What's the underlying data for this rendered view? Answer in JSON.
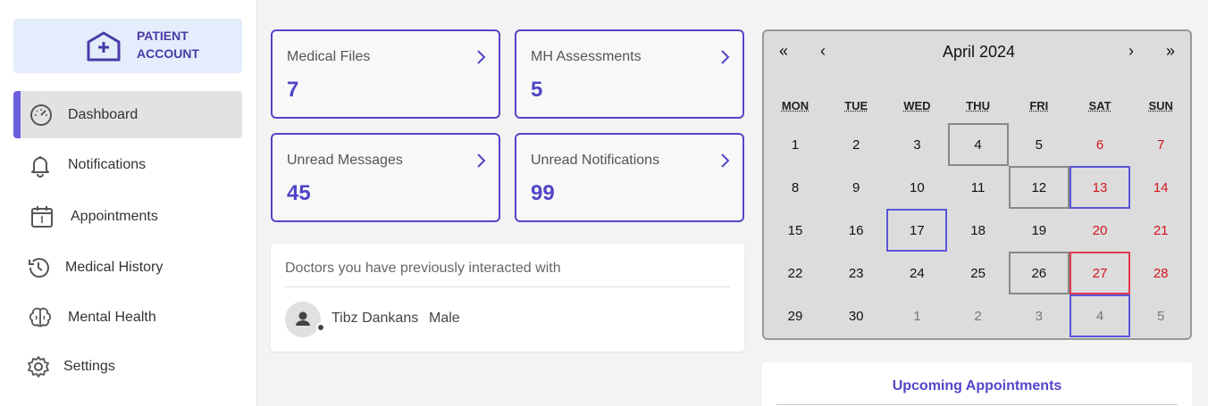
{
  "account": {
    "line1": "PATIENT",
    "line2": "ACCOUNT"
  },
  "nav": [
    {
      "label": "Dashboard",
      "icon": "gauge-icon",
      "active": true
    },
    {
      "label": "Notifications",
      "icon": "bell-icon"
    },
    {
      "label": "Appointments",
      "icon": "calendar-icon"
    },
    {
      "label": "Medical History",
      "icon": "history-icon"
    },
    {
      "label": "Mental Health",
      "icon": "brain-icon"
    },
    {
      "label": "Settings",
      "icon": "gear-icon"
    }
  ],
  "cards": [
    {
      "title": "Medical Files",
      "value": "7"
    },
    {
      "title": "MH Assessments",
      "value": "5"
    },
    {
      "title": "Unread Messages",
      "value": "45"
    },
    {
      "title": "Unread Notifications",
      "value": "99"
    }
  ],
  "doctors": {
    "heading": "Doctors you have previously interacted with",
    "items": [
      {
        "name": "Tibz Dankans",
        "gender": "Male"
      }
    ]
  },
  "calendar": {
    "title": "April 2024",
    "nav": {
      "prev_year": "«",
      "prev_month": "‹",
      "next_month": "›",
      "next_year": "»"
    },
    "weekdays": [
      "MON",
      "TUE",
      "WED",
      "THU",
      "FRI",
      "SAT",
      "SUN"
    ],
    "weeks": [
      [
        "1",
        "2",
        "3",
        "4",
        "5",
        "6",
        "7"
      ],
      [
        "8",
        "9",
        "10",
        "11",
        "12",
        "13",
        "14"
      ],
      [
        "15",
        "16",
        "17",
        "18",
        "19",
        "20",
        "21"
      ],
      [
        "22",
        "23",
        "24",
        "25",
        "26",
        "27",
        "28"
      ],
      [
        "29",
        "30",
        "1",
        "2",
        "3",
        "4",
        "5"
      ]
    ],
    "other_month_days": [
      "1",
      "2",
      "3",
      "4",
      "5"
    ],
    "highlighted_gray": [
      "4",
      "12",
      "26"
    ],
    "highlighted_blue": [
      "13",
      "17",
      "4 (May)"
    ],
    "highlighted_red": [
      "27"
    ],
    "colors": {
      "accent": "#5346c9",
      "weekend": "#d0161c",
      "today": "#e03a4f"
    }
  },
  "upcoming": {
    "title": "Upcoming Appointments"
  }
}
